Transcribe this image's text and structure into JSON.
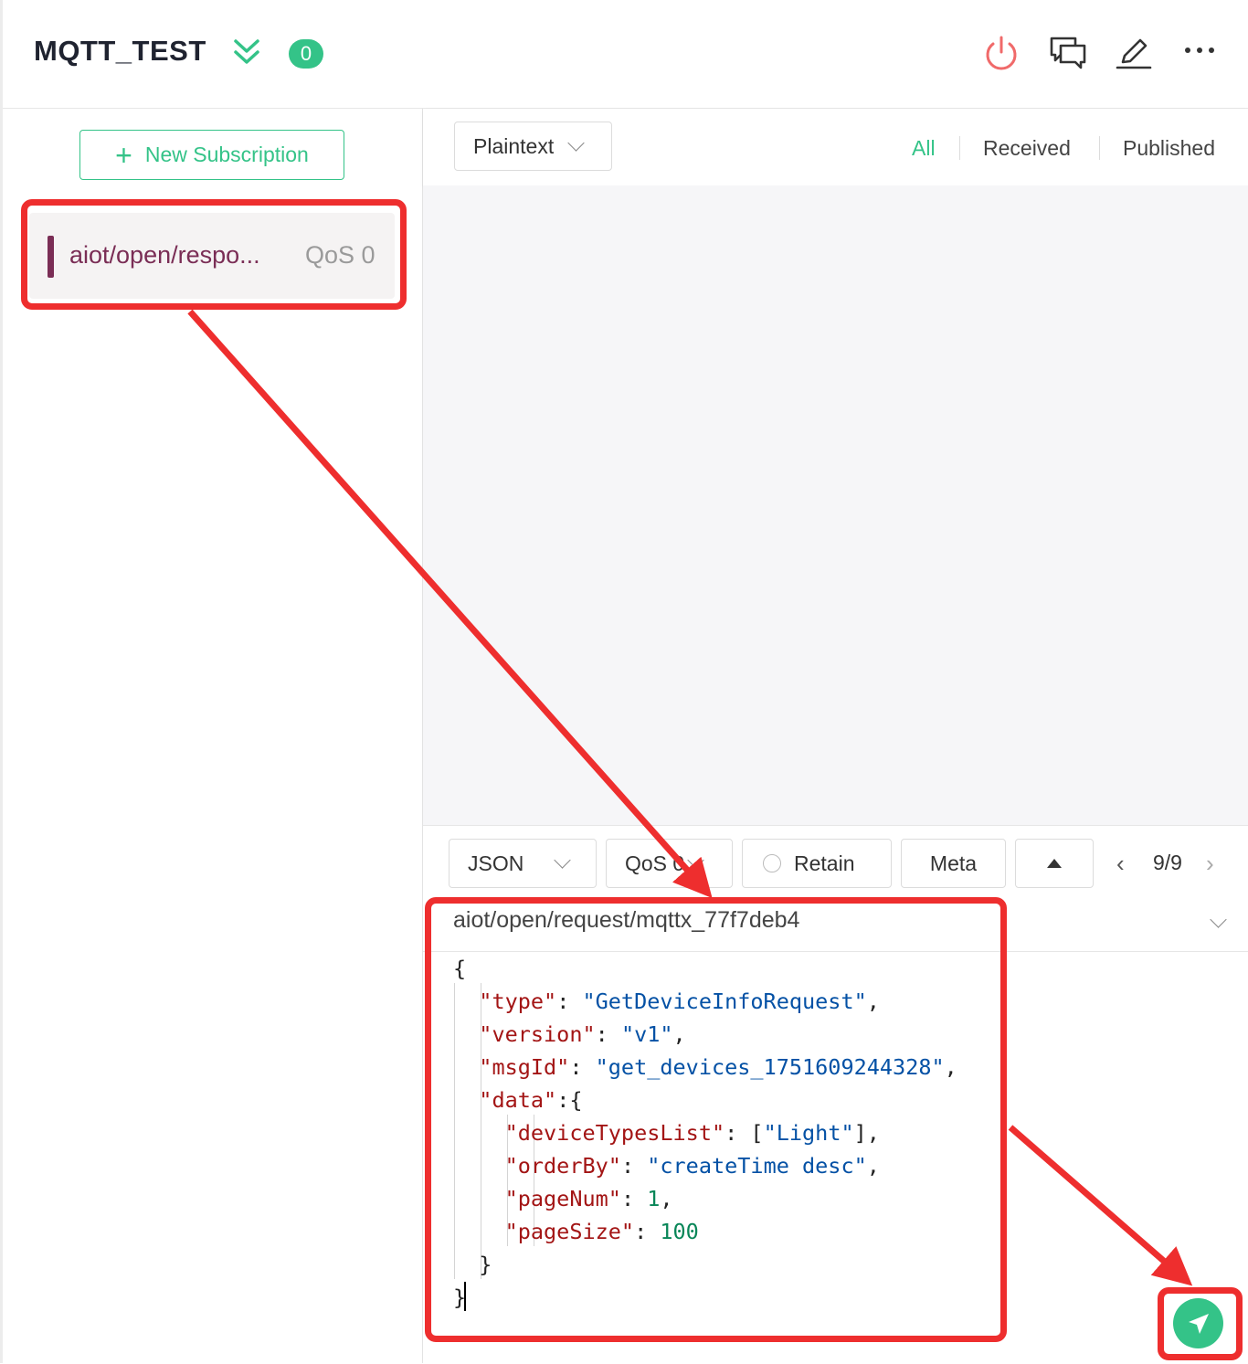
{
  "header": {
    "title": "MQTT_TEST",
    "badge_count": "0",
    "icons": [
      "chevrons-down-icon",
      "power-icon",
      "chat-bubbles-icon",
      "edit-icon",
      "more-icon"
    ]
  },
  "sidebar": {
    "new_subscription_label": "New Subscription",
    "subscriptions": [
      {
        "topic": "aiot/open/respo...",
        "qos": "QoS 0",
        "color": "#7a2d55"
      }
    ]
  },
  "messages": {
    "format_select": "Plaintext",
    "tabs": [
      "All",
      "Received",
      "Published"
    ],
    "active_tab": "All"
  },
  "publish": {
    "payload_format": "JSON",
    "qos_select": "QoS 0",
    "retain_label": "Retain",
    "meta_label": "Meta",
    "pager": "9/9",
    "topic": "aiot/open/request/mqttx_77f7deb4",
    "payload_lines": [
      "{",
      "\"type\": \"GetDeviceInfoRequest\",",
      "\"version\": \"v1\",",
      "\"msgId\": \"get_devices_1751609244328\",",
      "\"data\":{",
      "\"deviceTypesList\": [\"Light\"],",
      "\"orderBy\": \"createTime desc\",",
      "\"pageNum\": 1,",
      "\"pageSize\": 100",
      "}",
      "}"
    ]
  },
  "colors": {
    "accent": "#34c388",
    "annotation": "#ee2e2e",
    "subscription": "#7a2d55"
  }
}
